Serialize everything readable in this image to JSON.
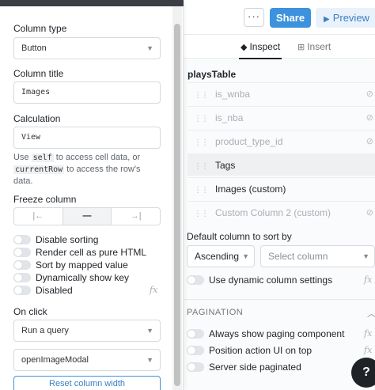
{
  "header": {
    "more_label": "···",
    "share_label": "Share",
    "preview_label": "Preview"
  },
  "tabs": [
    {
      "label": "Inspect",
      "active": true
    },
    {
      "label": "Insert",
      "active": false
    }
  ],
  "inspector": {
    "table_name": "playsTable",
    "columns": [
      {
        "label": "is_wnba",
        "hidden": true
      },
      {
        "label": "is_nba",
        "hidden": true
      },
      {
        "label": "product_type_id",
        "hidden": true
      },
      {
        "label": "Tags",
        "hidden": false
      },
      {
        "label": "Images (custom)",
        "hidden": false
      },
      {
        "label": "Custom Column 2 (custom)",
        "hidden": true
      }
    ],
    "sort": {
      "label": "Default column to sort by",
      "direction": "Ascending",
      "column_placeholder": "Select column"
    },
    "dynamic_settings_label": "Use dynamic column settings",
    "pagination": {
      "title": "PAGINATION",
      "options": [
        "Always show paging component",
        "Position action UI on top",
        "Server side paginated"
      ]
    },
    "fx_label": "fx",
    "help_label": "?"
  },
  "editor": {
    "column_type_label": "Column type",
    "column_type_value": "Button",
    "column_title_label": "Column title",
    "column_title_value": "Images",
    "calculation_label": "Calculation",
    "calculation_value": "View",
    "help_text": {
      "use": "Use",
      "self": "self",
      "mid": "to access cell data, or",
      "current_row": "currentRow",
      "end": "to access the row's data."
    },
    "freeze_label": "Freeze column",
    "freeze_options": [
      "|←",
      "—",
      "→|"
    ],
    "toggles": [
      "Disable sorting",
      "Render cell as pure HTML",
      "Sort by mapped value",
      "Dynamically show key",
      "Disabled"
    ],
    "on_click_label": "On click",
    "on_click_action": "Run a query",
    "on_click_query": "openImageModal",
    "reset_label": "Reset column width"
  },
  "colors": {
    "accent": "#3c92dc",
    "dark": "#1f2328"
  }
}
